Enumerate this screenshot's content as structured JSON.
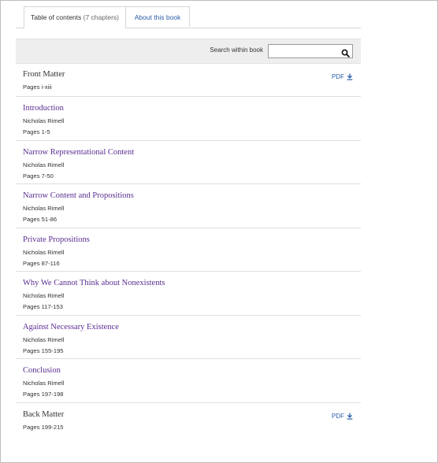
{
  "tabs": {
    "toc_label": "Table of contents",
    "toc_count": "(7 chapters)",
    "about_label": "About this book"
  },
  "search": {
    "label": "Search within book",
    "value": "",
    "icon": "search-icon"
  },
  "accent": {
    "link": "#5a2d91",
    "pdf": "#2a5ea8"
  },
  "front_matter": {
    "title": "Front Matter",
    "pages": "Pages i-xiii",
    "pdf_label": "PDF"
  },
  "chapters": [
    {
      "title": "Introduction",
      "author": "Nicholas Rimell",
      "pages": "Pages 1-5"
    },
    {
      "title": "Narrow Representational Content",
      "author": "Nicholas Rimell",
      "pages": "Pages 7-50"
    },
    {
      "title": "Narrow Content and Propositions",
      "author": "Nicholas Rimell",
      "pages": "Pages 51-86"
    },
    {
      "title": "Private Propositions",
      "author": "Nicholas Rimell",
      "pages": "Pages 87-116"
    },
    {
      "title": "Why We Cannot Think about Nonexistents",
      "author": "Nicholas Rimell",
      "pages": "Pages 117-153"
    },
    {
      "title": "Against Necessary Existence",
      "author": "Nicholas Rimell",
      "pages": "Pages 155-195"
    },
    {
      "title": "Conclusion",
      "author": "Nicholas Rimell",
      "pages": "Pages 197-198"
    }
  ],
  "back_matter": {
    "title": "Back Matter",
    "pages": "Pages 199-215",
    "pdf_label": "PDF"
  }
}
